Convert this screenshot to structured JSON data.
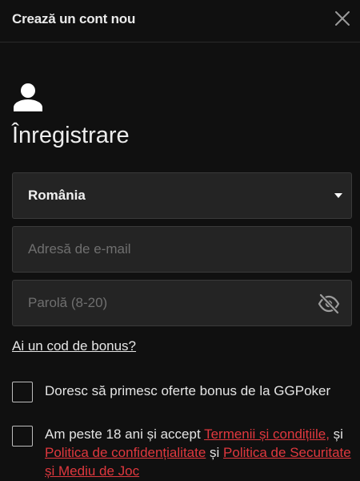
{
  "header": {
    "title": "Crează un cont nou",
    "close_icon": "close-icon"
  },
  "main": {
    "user_icon": "user-icon",
    "title": "Înregistrare",
    "country_select": {
      "value": "România",
      "icon": "chevron-down-icon"
    },
    "email_input": {
      "value": "",
      "placeholder": "Adresă de e-mail"
    },
    "password_input": {
      "value": "",
      "placeholder": "Parolă (8-20)",
      "icon": "eye-off-icon"
    },
    "bonus_code_link": "Ai un cod de bonus?",
    "offers_checkbox": {
      "checked": false,
      "label": "Doresc să primesc oferte bonus de la GGPoker"
    },
    "terms_checkbox": {
      "checked": false,
      "text_before": "Am peste 18 ani și accept ",
      "terms_link": "Termenii și condițiile,",
      "text_middle": " și ",
      "privacy_link": "Politica de confidențialitate",
      "text_after": " și ",
      "security_link": "Politica de Securitate și Mediu de Joc"
    }
  },
  "colors": {
    "background": "#101010",
    "field_background": "#242424",
    "link_red": "#e0383e"
  }
}
